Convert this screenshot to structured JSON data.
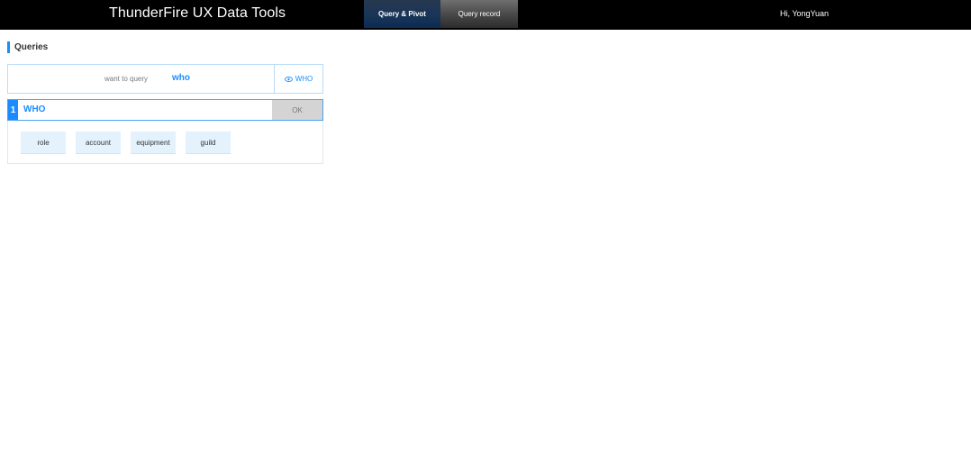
{
  "header": {
    "app_title": "ThunderFire UX Data Tools",
    "tabs": [
      {
        "label": "Query & Pivot",
        "active": true
      },
      {
        "label": "Query record",
        "active": false
      }
    ],
    "greeting": "Hi,  YongYuan"
  },
  "section": {
    "title": "Queries"
  },
  "query_bar": {
    "label": "want to query",
    "value": "who",
    "preview_label": "WHO",
    "preview_icon": "eye-icon"
  },
  "step": {
    "number": "1",
    "title": "WHO",
    "ok_label": "OK",
    "options": [
      "role",
      "account",
      "equipment",
      "guild"
    ]
  },
  "colors": {
    "accent": "#1a8cff",
    "topbar": "#000000",
    "chip_bg": "#e3f2fd",
    "ok_bg": "#d4d4d4"
  }
}
